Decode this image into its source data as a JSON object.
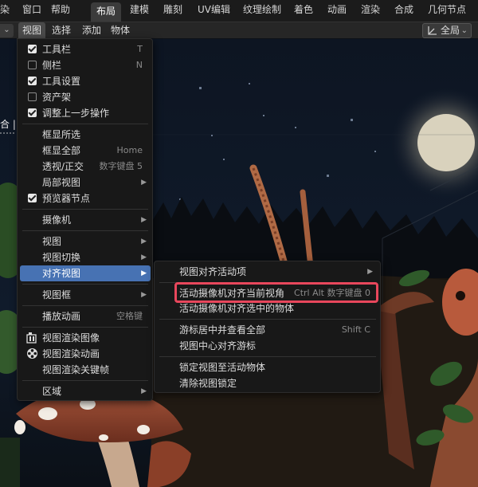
{
  "topbar": {
    "items": [
      {
        "label": "染",
        "active": false
      },
      {
        "label": "窗口",
        "active": false
      },
      {
        "label": "帮助",
        "active": false
      },
      {
        "label": "布局",
        "active": true
      },
      {
        "label": "建模",
        "active": false
      },
      {
        "label": "雕刻",
        "active": false
      },
      {
        "label": "UV编辑",
        "active": false
      },
      {
        "label": "纹理绘制",
        "active": false
      },
      {
        "label": "着色",
        "active": false
      },
      {
        "label": "动画",
        "active": false
      },
      {
        "label": "渲染",
        "active": false
      },
      {
        "label": "合成",
        "active": false
      },
      {
        "label": "几何节点",
        "active": false
      }
    ]
  },
  "header": {
    "menus": [
      "视图",
      "选择",
      "添加",
      "物体"
    ],
    "transform_orientation": "全局"
  },
  "viewport": {
    "left_edge_text": "合 | ("
  },
  "menu": {
    "items": [
      {
        "label": "工具栏",
        "shortcut": "T",
        "check": true
      },
      {
        "label": "侧栏",
        "shortcut": "N",
        "check": false
      },
      {
        "label": "工具设置",
        "shortcut": "",
        "check": true
      },
      {
        "label": "资产架",
        "shortcut": "",
        "check": false
      },
      {
        "label": "调整上一步操作",
        "shortcut": "",
        "check": true
      },
      {
        "label": "框显所选",
        "shortcut": ""
      },
      {
        "label": "框显全部",
        "shortcut": "Home"
      },
      {
        "label": "透视/正交",
        "shortcut": "数字键盘 5"
      },
      {
        "label": "局部视图",
        "shortcut": "",
        "submenu": true
      },
      {
        "label": "预览器节点",
        "shortcut": "",
        "check": true
      },
      {
        "label": "摄像机",
        "shortcut": "",
        "submenu": true
      },
      {
        "label": "视图",
        "shortcut": "",
        "submenu": true
      },
      {
        "label": "视图切换",
        "shortcut": "",
        "submenu": true
      },
      {
        "label": "对齐视图",
        "shortcut": "",
        "submenu": true,
        "highlighted": true
      },
      {
        "label": "视图框",
        "shortcut": "",
        "submenu": true
      },
      {
        "label": "播放动画",
        "shortcut": "空格键"
      },
      {
        "label": "视图渲染图像",
        "shortcut": "",
        "icon": "render-image-icon"
      },
      {
        "label": "视图渲染动画",
        "shortcut": "",
        "icon": "render-animation-icon"
      },
      {
        "label": "视图渲染关键帧",
        "shortcut": ""
      },
      {
        "label": "区域",
        "shortcut": "",
        "submenu": true
      }
    ]
  },
  "submenu": {
    "items": [
      {
        "label": "视图对齐活动项",
        "shortcut": "",
        "submenu": true
      },
      {
        "label": "活动摄像机对齐当前视角",
        "shortcut": "Ctrl Alt 数字键盘 0",
        "focused": true
      },
      {
        "label": "活动摄像机对齐选中的物体",
        "shortcut": ""
      },
      {
        "label": "游标居中并查看全部",
        "shortcut": "Shift C"
      },
      {
        "label": "视图中心对齐游标",
        "shortcut": ""
      },
      {
        "label": "锁定视图至活动物体",
        "shortcut": ""
      },
      {
        "label": "清除视图锁定",
        "shortcut": ""
      }
    ]
  },
  "colors": {
    "menu_bg": "#181818",
    "highlight": "#4772b3",
    "focus_outline": "#e8475c",
    "topbar_bg": "#1b1b1b",
    "header_bg": "#262626"
  }
}
